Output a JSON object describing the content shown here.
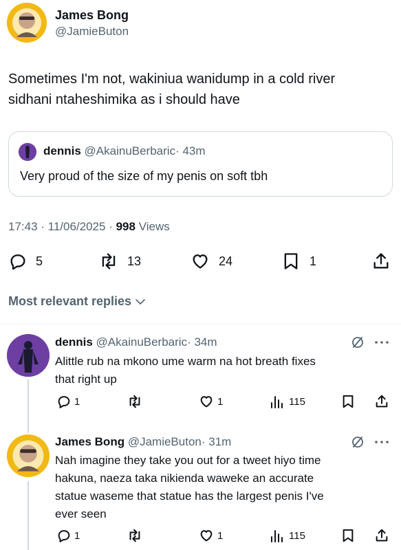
{
  "tweet": {
    "author_name": "James Bong",
    "author_handle": "@JamieButon",
    "text_line1": "Sometimes I'm not, wakiniua wanidump in a cold river",
    "text_line2": "sidhani ntaheshimika as i should have",
    "quote": {
      "author_name": "dennis",
      "author_handle": "@AkainuBerbaric",
      "time": "· 43m",
      "text": "Very proud of the size of my penis on soft tbh"
    },
    "meta_time": "17:43 · 11/06/2025 ·",
    "views_count": "998",
    "views_label": "Views",
    "actions": {
      "replies": "5",
      "reposts": "13",
      "likes": "24",
      "bookmarks": "1"
    }
  },
  "replies_sort": {
    "label": "Most relevant replies"
  },
  "replies": [
    {
      "author_name": "dennis",
      "author_handle": "@AkainuBerbaric",
      "time": "· 34m",
      "line1": "Alittle rub na mkono ume warm na hot breath fixes",
      "line2": "that right up",
      "replies": "1",
      "likes": "1",
      "views": "115"
    },
    {
      "author_name": "James Bong",
      "author_handle": "@JamieButon",
      "time": "· 31m",
      "line1": "Nah imagine they take you out for a tweet hiyo time",
      "line2": "hakuna, naeza taka nikienda waweke an accurate",
      "line3": "statue waseme that statue has the largest penis I've",
      "line4": "ever seen",
      "replies": "1",
      "likes": "1",
      "views": "115"
    }
  ],
  "colors": {
    "text": "#0f1419",
    "muted": "#536471",
    "divider": "#eff3f4",
    "avatar_yellow": "#f2b915",
    "avatar_purple": "#6d3fa3"
  },
  "icons": [
    "reply-icon",
    "repost-icon",
    "like-icon",
    "bookmark-icon",
    "share-icon",
    "views-icon",
    "grok-icon",
    "more-icon",
    "chevron-down-icon"
  ]
}
